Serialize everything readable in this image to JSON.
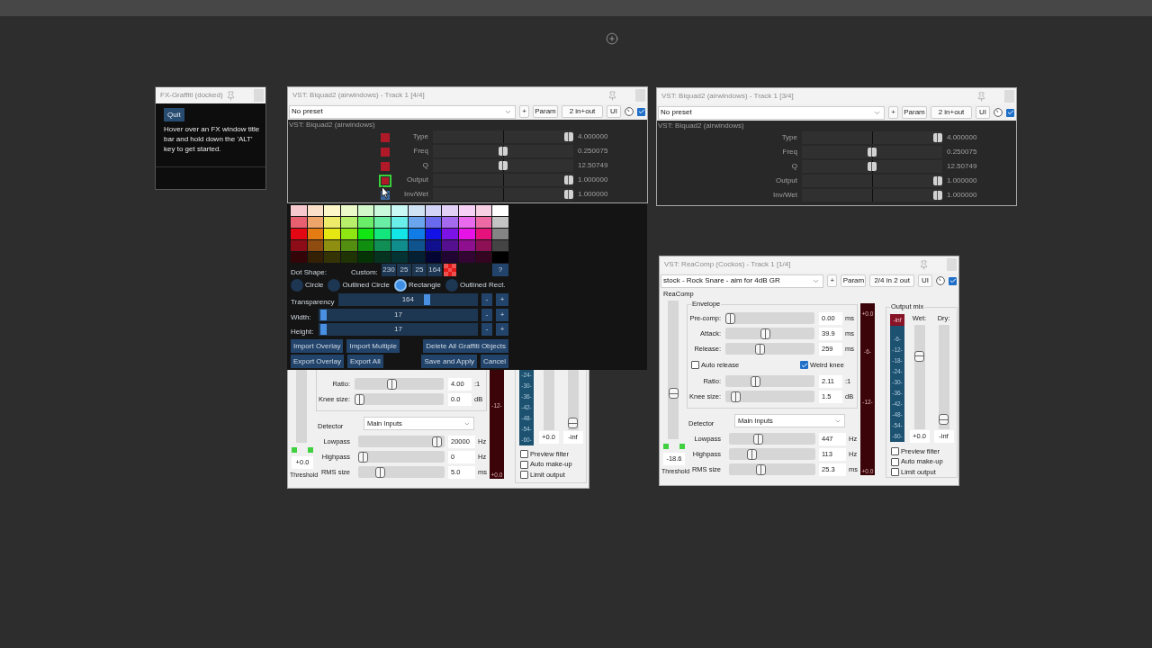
{
  "graffiti_panel": {
    "title": "FX-Graffiti (docked)",
    "quit_label": "Quit",
    "hint": "Hover over an FX window title bar and hold down the 'ALT' key to get started."
  },
  "biquad_windows": [
    {
      "title": "VST: Biquad2 (airwindows) - Track 1 [4/4]",
      "preset": "No preset",
      "buttons": [
        "+",
        "Param",
        "2 in+out",
        "UI"
      ],
      "enabled": true,
      "plugin_label": "VST: Biquad2 (airwindows)",
      "params": [
        {
          "name": "Type",
          "level": 1,
          "value": "4.000000"
        },
        {
          "name": "Freq",
          "level": 0.5,
          "value": "0.250075"
        },
        {
          "name": "Q",
          "level": 0.5,
          "value": "12.50749"
        },
        {
          "name": "Output",
          "level": 1,
          "value": "1.000000"
        },
        {
          "name": "Inv/Wet",
          "level": 1,
          "value": "1.000000"
        }
      ],
      "graffiti_dots": [
        {
          "color": "#b01a28",
          "selected": false
        },
        {
          "color": "#b01a28",
          "selected": false
        },
        {
          "color": "#b01a28",
          "selected": false
        },
        {
          "color": "#b01a28",
          "selected": true
        },
        {
          "color": "#3c6aa0",
          "selected": false
        }
      ]
    },
    {
      "title": "VST: Biquad2 (airwindows) - Track 1 [3/4]",
      "preset": "No preset",
      "buttons": [
        "+",
        "Param",
        "2 in+out",
        "UI"
      ],
      "enabled": true,
      "plugin_label": "VST: Biquad2 (airwindows)",
      "params": [
        {
          "name": "Type",
          "level": 1,
          "value": "4.000000"
        },
        {
          "name": "Freq",
          "level": 0.5,
          "value": "0.250075"
        },
        {
          "name": "Q",
          "level": 0.5,
          "value": "12.50749"
        },
        {
          "name": "Output",
          "level": 1,
          "value": "1.000000"
        },
        {
          "name": "Inv/Wet",
          "level": 1,
          "value": "1.000000"
        }
      ]
    }
  ],
  "color_panel": {
    "palette": [
      {
        "color": "#f7c9cf"
      },
      {
        "color": "#fbe0c9"
      },
      {
        "color": "#fdf7c9"
      },
      {
        "color": "#ecf9c9"
      },
      {
        "color": "#d3f9cb"
      },
      {
        "color": "#cbf9dc"
      },
      {
        "color": "#cbf9f5"
      },
      {
        "color": "#d0e3f5"
      },
      {
        "color": "#d3d3f7"
      },
      {
        "color": "#e3d0f7"
      },
      {
        "color": "#f7d0f5"
      },
      {
        "color": "#f7d0e3"
      },
      {
        "color": "#ffffff"
      },
      {
        "color": "#e8606f"
      },
      {
        "color": "#eea56a"
      },
      {
        "color": "#eeea6a"
      },
      {
        "color": "#b7ee6a"
      },
      {
        "color": "#6aee6a"
      },
      {
        "color": "#6aeea5"
      },
      {
        "color": "#6aeeea"
      },
      {
        "color": "#6aa5ee"
      },
      {
        "color": "#6a6aee"
      },
      {
        "color": "#a56aee"
      },
      {
        "color": "#ea6aee"
      },
      {
        "color": "#ee6aa5"
      },
      {
        "color": "#c4c4c4"
      },
      {
        "color": "#e30613"
      },
      {
        "color": "#e57c12"
      },
      {
        "color": "#e6e612"
      },
      {
        "color": "#8ee612"
      },
      {
        "color": "#12e612"
      },
      {
        "color": "#12e67c"
      },
      {
        "color": "#12e6e6"
      },
      {
        "color": "#127ce6"
      },
      {
        "color": "#1212e6"
      },
      {
        "color": "#7c12e6"
      },
      {
        "color": "#e612e6"
      },
      {
        "color": "#e6127c"
      },
      {
        "color": "#848484"
      },
      {
        "color": "#8e0c17"
      },
      {
        "color": "#8e4c10"
      },
      {
        "color": "#8e8e10"
      },
      {
        "color": "#548e10"
      },
      {
        "color": "#108e10"
      },
      {
        "color": "#108e54"
      },
      {
        "color": "#108e8e"
      },
      {
        "color": "#10548e"
      },
      {
        "color": "#10108e"
      },
      {
        "color": "#54108e"
      },
      {
        "color": "#8e108e"
      },
      {
        "color": "#8e1054"
      },
      {
        "color": "#444444"
      },
      {
        "color": "#330408"
      },
      {
        "color": "#332005"
      },
      {
        "color": "#333305"
      },
      {
        "color": "#203305"
      },
      {
        "color": "#053305"
      },
      {
        "color": "#053320"
      },
      {
        "color": "#053333"
      },
      {
        "color": "#052033"
      },
      {
        "color": "#050533"
      },
      {
        "color": "#200533"
      },
      {
        "color": "#330533"
      },
      {
        "color": "#330520"
      },
      {
        "color": "#000000"
      }
    ],
    "dot_shape_label": "Dot Shape:",
    "custom": {
      "label": "Custom:",
      "values": [
        "230",
        "25",
        "25",
        "164"
      ],
      "color": "#e61919"
    },
    "help_button": "?",
    "shapes": [
      {
        "label": "Circle",
        "selected": false
      },
      {
        "label": "Outlined Circle",
        "selected": false
      },
      {
        "label": "Rectangle",
        "selected": true
      },
      {
        "label": "Outlined Rect.",
        "selected": false
      }
    ],
    "sliders": [
      {
        "label": "Transparency",
        "value": "164",
        "level": 0.64,
        "buttons": [
          "-",
          "+"
        ]
      },
      {
        "label": "Width:",
        "value": "17",
        "level": 0.01,
        "buttons": [
          "-",
          "+"
        ]
      },
      {
        "label": "Height:",
        "value": "17",
        "level": 0.01,
        "buttons": [
          "-",
          "+"
        ]
      }
    ],
    "button_rows": [
      {
        "left": [
          "Import Overlay",
          "Import Multiple"
        ],
        "right": [
          "Delete All Graffiti Objects"
        ]
      },
      {
        "left": [
          "Export Overlay",
          "Export All"
        ],
        "right": [
          "Save and Apply",
          "Cancel"
        ]
      }
    ]
  },
  "reacomp_windows": [
    {
      "kind": "lower_part",
      "threshold": {
        "value": "+0.0",
        "label": "Threshold"
      },
      "envelope_rows": [
        {
          "kind": "slider",
          "label": "Ratio:",
          "level": 0.41,
          "value": "4.00",
          "unit": ":1"
        },
        {
          "kind": "slider",
          "label": "Knee size:",
          "level": 0,
          "value": "0.0",
          "unit": "dB"
        }
      ],
      "detector": {
        "label": "Detector",
        "value": "Main Inputs"
      },
      "filter_rows": [
        {
          "label": "Lowpass",
          "level": 0.97,
          "value": "20000",
          "unit": "Hz"
        },
        {
          "label": "Highpass",
          "level": 0,
          "value": "0",
          "unit": "Hz"
        },
        {
          "label": "RMS size",
          "level": 0.22,
          "value": "5.0",
          "unit": "ms"
        }
      ],
      "input_meter": {
        "labels": [
          "-12-",
          "+0.0"
        ]
      },
      "output_mix": {
        "meter_labels": [
          "-24-",
          "-30-",
          "-36-",
          "-42-",
          "-48-",
          "-54-",
          "-60-"
        ],
        "wet": {
          "value": "+0.0"
        },
        "dry": {
          "level": 0.02,
          "value": "-inf"
        },
        "options": [
          {
            "label": "Preview filter",
            "checked": false
          },
          {
            "label": "Auto make-up",
            "checked": false
          },
          {
            "label": "Limit output",
            "checked": false
          }
        ]
      }
    },
    {
      "kind": "full",
      "title": "VST: ReaComp (Cockos) - Track 1 [1/4]",
      "preset": "stock - Rock Snare - aim for 4dB GR",
      "buttons": [
        "+",
        "Param",
        "2/4 in 2 out",
        "UI"
      ],
      "enabled": true,
      "group_label": "ReaComp",
      "threshold": {
        "level": 0.32,
        "value": "-18.6",
        "label": "Threshold"
      },
      "envelope_label": "Envelope",
      "envelope_rows": [
        {
          "kind": "slider",
          "label": "Pre-comp:",
          "level": 0,
          "value": "0.00",
          "unit": "ms"
        },
        {
          "kind": "slider",
          "label": "Attack:",
          "level": 0.44,
          "value": "39.9",
          "unit": "ms"
        },
        {
          "kind": "slider",
          "label": "Release:",
          "level": 0.37,
          "value": "259",
          "unit": "ms"
        },
        {
          "kind": "checkboxes",
          "items": [
            {
              "label": "Auto release",
              "checked": false
            },
            {
              "label": "Weird knee",
              "checked": true
            }
          ]
        },
        {
          "kind": "slider",
          "label": "Ratio:",
          "level": 0.32,
          "value": "2.11",
          "unit": ":1"
        },
        {
          "kind": "slider",
          "label": "Knee size:",
          "level": 0.07,
          "value": "1.5",
          "unit": "dB"
        }
      ],
      "detector": {
        "label": "Detector",
        "value": "Main Inputs"
      },
      "filter_rows": [
        {
          "label": "Lowpass",
          "level": 0.32,
          "value": "447",
          "unit": "Hz"
        },
        {
          "label": "Highpass",
          "level": 0.23,
          "value": "113",
          "unit": "Hz"
        },
        {
          "label": "RMS size",
          "level": 0.35,
          "value": "25.3",
          "unit": "ms"
        }
      ],
      "input_meter": {
        "labels": [
          "+0.0",
          "-6-",
          "-12-",
          "+0.0"
        ]
      },
      "output_mix": {
        "label": "Output mix",
        "meter_peak": "-inf",
        "meter_labels": [
          "-6-",
          "-12-",
          "-18-",
          "-24-",
          "-30-",
          "-36-",
          "-42-",
          "-48-",
          "-54-",
          "-60-"
        ],
        "wet": {
          "label": "Wet:",
          "level": 0.72,
          "value": "+0.0"
        },
        "dry": {
          "label": "Dry:",
          "level": 0.05,
          "value": "-inf"
        },
        "options": [
          {
            "label": "Preview filter",
            "checked": false
          },
          {
            "label": "Auto make-up",
            "checked": false
          },
          {
            "label": "Limit output",
            "checked": false
          }
        ]
      }
    }
  ]
}
